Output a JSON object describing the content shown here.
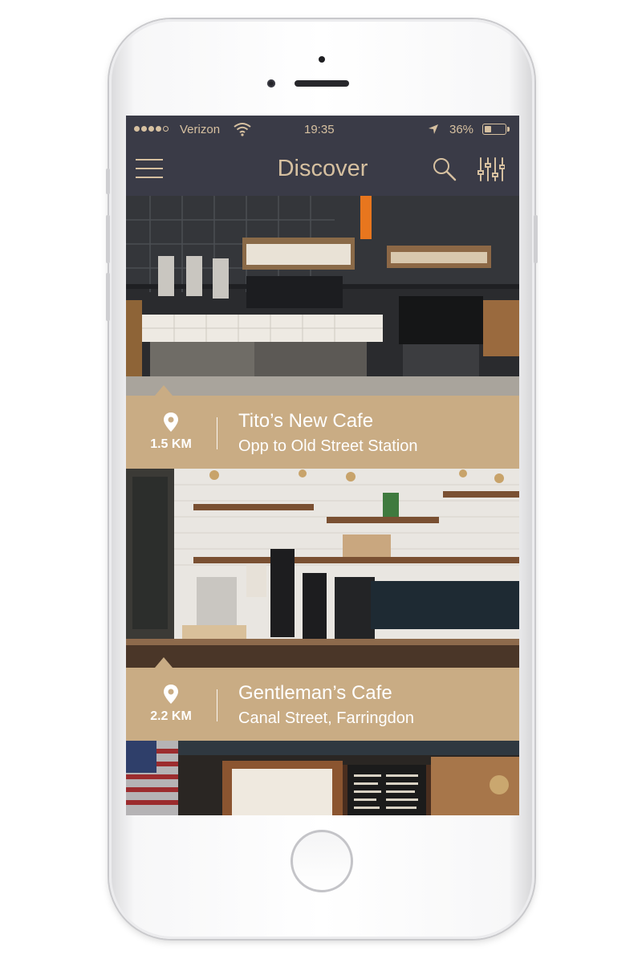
{
  "status_bar": {
    "carrier": "Verizon",
    "time": "19:35",
    "battery": "36%",
    "battery_level": 0.36
  },
  "nav": {
    "title": "Discover",
    "menu_icon": "hamburger-menu-icon",
    "search_icon": "search-icon",
    "filter_icon": "sliders-filter-icon"
  },
  "colors": {
    "bar_background": "#3a3b47",
    "accent": "#d6c0a0",
    "card_info_background": "#c9ac84"
  },
  "cafes": [
    {
      "name": "Tito’s New Cafe",
      "address": "Opp to Old Street Station",
      "distance": "1.5 KM"
    },
    {
      "name": "Gentleman’s Cafe",
      "address": "Canal Street, Farringdon",
      "distance": "2.2 KM"
    }
  ]
}
